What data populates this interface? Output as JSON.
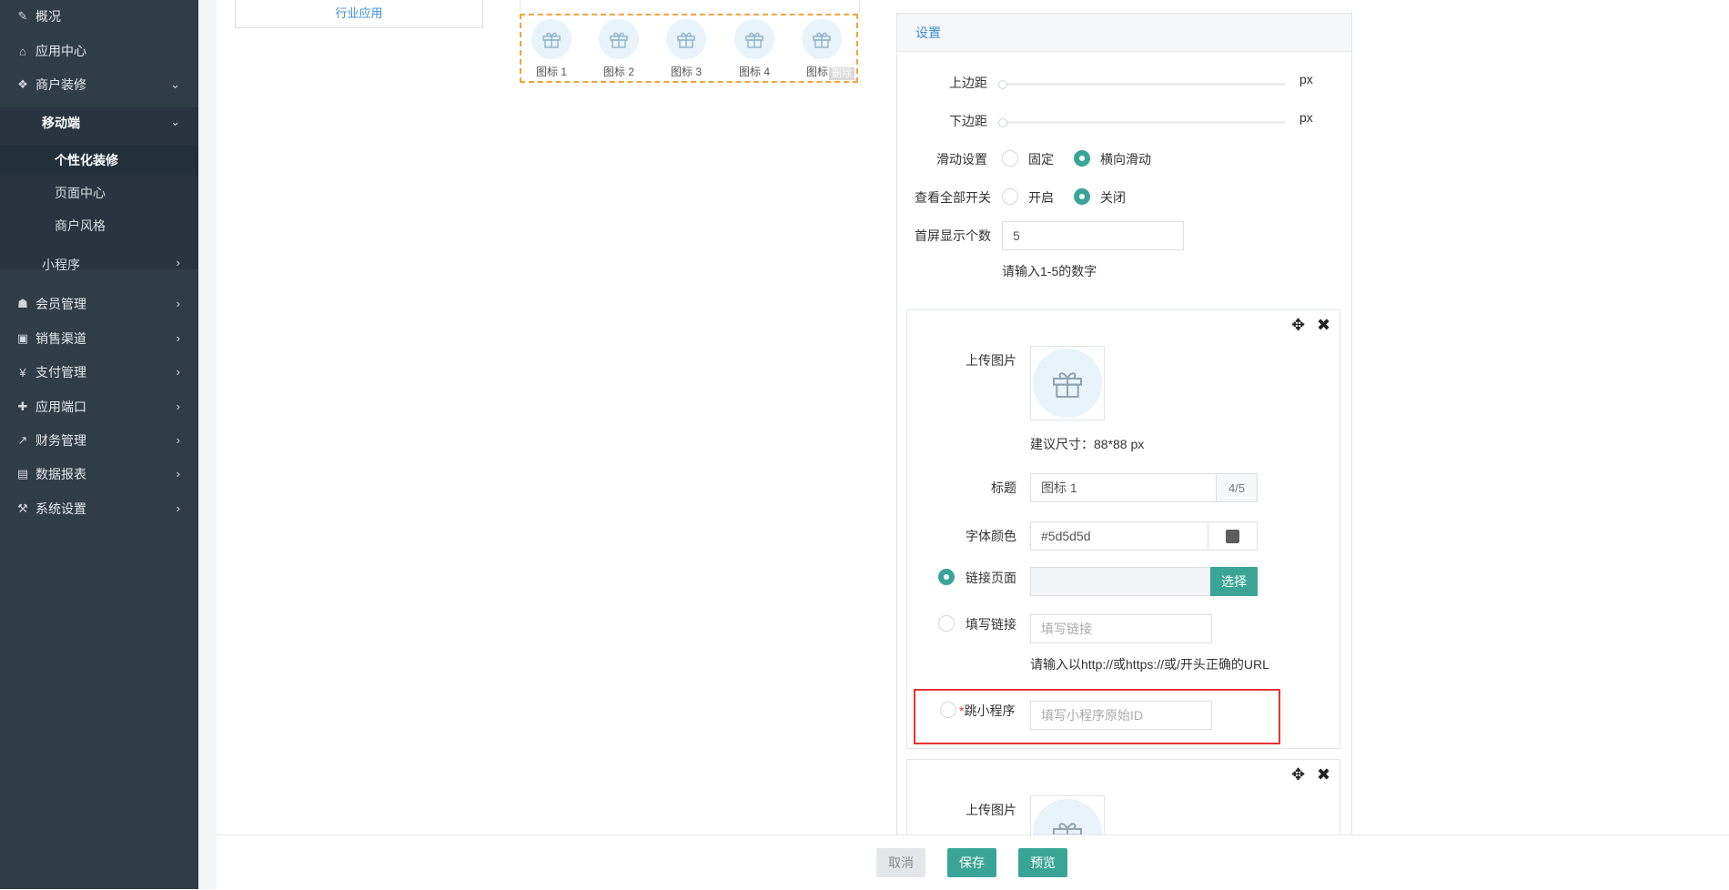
{
  "sidebar": {
    "items": [
      {
        "icon": "edit-icon",
        "label": "概况"
      },
      {
        "icon": "home-icon",
        "label": "应用中心"
      },
      {
        "icon": "cubes-icon",
        "label": "商户装修"
      },
      {
        "icon": "users-icon",
        "label": "会员管理"
      },
      {
        "icon": "money-icon",
        "label": "销售渠道"
      },
      {
        "icon": "yen-icon",
        "label": "支付管理"
      },
      {
        "icon": "puzzle-icon",
        "label": "应用端口"
      },
      {
        "icon": "line-chart-icon",
        "label": "财务管理"
      },
      {
        "icon": "calendar-icon",
        "label": "数据报表"
      },
      {
        "icon": "gavel-icon",
        "label": "系统设置"
      }
    ],
    "sub": {
      "mobile": "移动端",
      "personalize": "个性化装修",
      "page_center": "页面中心",
      "merchant_style": "商户风格",
      "mini_program": "小程序"
    }
  },
  "left_card": {
    "label": "行业应用"
  },
  "preview": {
    "icons": [
      "图标 1",
      "图标 2",
      "图标 3",
      "图标 4",
      "图标 5"
    ],
    "delete_label": "删除"
  },
  "panel": {
    "title": "设置",
    "top_margin": {
      "label": "上边距",
      "unit": "px",
      "value": 0
    },
    "bottom_margin": {
      "label": "下边距",
      "unit": "px",
      "value": 0
    },
    "scroll": {
      "label": "滑动设置",
      "options": [
        "固定",
        "横向滑动"
      ],
      "selected": "横向滑动"
    },
    "view_all": {
      "label": "查看全部开关",
      "options": [
        "开启",
        "关闭"
      ],
      "selected": "关闭"
    },
    "first_screen": {
      "label": "首屏显示个数",
      "value": "5",
      "hint": "请输入1-5的数字"
    }
  },
  "item1": {
    "upload_label": "上传图片",
    "size_hint": "建议尺寸：88*88 px",
    "title_label": "标题",
    "title_value": "图标 1",
    "title_count": "4/5",
    "color_label": "字体颜色",
    "color_value": "#5d5d5d",
    "link_page_label": "链接页面",
    "link_select_btn": "选择",
    "custom_link_label": "填写链接",
    "custom_link_placeholder": "填写链接",
    "url_hint": "请输入以http://或https://或/开头正确的URL",
    "required_mark": "*",
    "mini_label": "跳小程序",
    "mini_placeholder": "填写小程序原始ID"
  },
  "item2": {
    "upload_label": "上传图片"
  },
  "footer": {
    "cancel": "取消",
    "save": "保存",
    "preview": "预览"
  }
}
